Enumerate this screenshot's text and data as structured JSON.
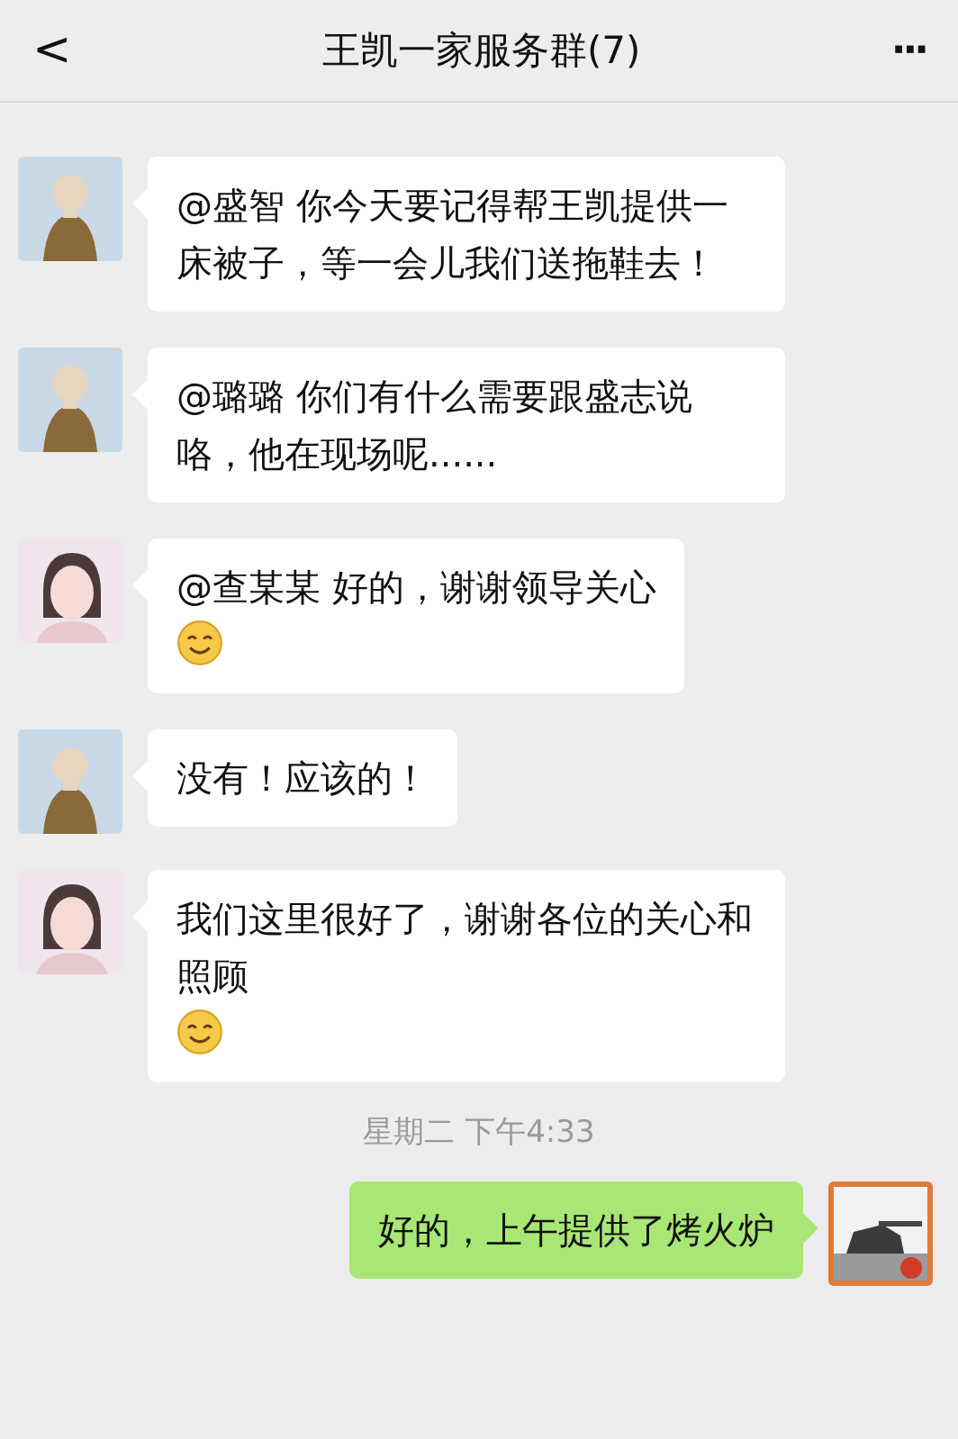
{
  "header": {
    "back": "<",
    "title": "王凯一家服务群(7)",
    "more": "···"
  },
  "messages": [
    {
      "kind": "incoming",
      "avatar": {
        "kind": "monk"
      },
      "text": "@盛智 你今天要记得帮王凯提供一床被子，等一会儿我们送拖鞋去！",
      "emoji": false
    },
    {
      "kind": "incoming",
      "avatar": {
        "kind": "monk"
      },
      "text": "@璐璐 你们有什么需要跟盛志说咯，他在现场呢......",
      "emoji": false
    },
    {
      "kind": "incoming",
      "avatar": {
        "kind": "girl"
      },
      "text": "@查某某 好的，谢谢领导关心",
      "emoji": true
    },
    {
      "kind": "incoming",
      "avatar": {
        "kind": "monk"
      },
      "text": "没有！应该的！",
      "emoji": false
    },
    {
      "kind": "incoming",
      "avatar": {
        "kind": "girl"
      },
      "text": "我们这里很好了，谢谢各位的关心和照顾",
      "emoji": true
    },
    {
      "kind": "time",
      "text": "星期二 下午4:33"
    },
    {
      "kind": "outgoing",
      "text": "好的，上午提供了烤火炉",
      "emoji": false
    }
  ]
}
